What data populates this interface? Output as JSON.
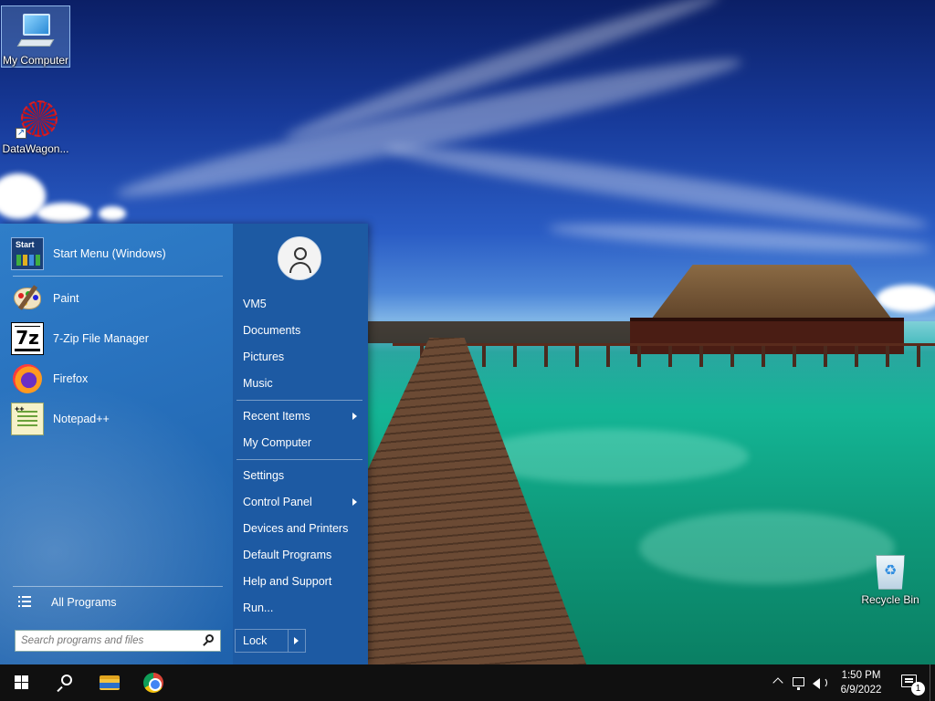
{
  "desktop": {
    "icons": [
      {
        "label": "My Computer",
        "icon": "computer-icon"
      },
      {
        "label": "DataWagon...",
        "icon": "datawagon-icon"
      },
      {
        "label": "Recycle Bin",
        "icon": "recycle-bin-icon"
      }
    ]
  },
  "start_menu": {
    "pinned": [
      {
        "label": "Start Menu (Windows)",
        "icon": "start-menu-app-icon"
      }
    ],
    "recent_programs": [
      {
        "label": "Paint",
        "icon": "paint-icon"
      },
      {
        "label": "7-Zip File Manager",
        "icon": "7zip-icon"
      },
      {
        "label": "Firefox",
        "icon": "firefox-icon"
      },
      {
        "label": "Notepad++",
        "icon": "notepad-plus-plus-icon"
      }
    ],
    "all_programs_label": "All Programs",
    "search_placeholder": "Search programs and files",
    "user_picture_icon": "user-icon",
    "right_items_group1": [
      "VM5",
      "Documents",
      "Pictures",
      "Music"
    ],
    "right_items_group2": [
      {
        "label": "Recent Items",
        "submenu": true
      },
      {
        "label": "My Computer",
        "submenu": false
      }
    ],
    "right_items_group3": [
      {
        "label": "Settings",
        "submenu": false
      },
      {
        "label": "Control Panel",
        "submenu": true
      },
      {
        "label": "Devices and Printers",
        "submenu": false
      },
      {
        "label": "Default Programs",
        "submenu": false
      },
      {
        "label": "Help and Support",
        "submenu": false
      },
      {
        "label": "Run...",
        "submenu": false
      }
    ],
    "lock_label": "Lock",
    "start_icon_text": "Start",
    "accent_color": "#2a74c0"
  },
  "taskbar": {
    "buttons": [
      "windows-start-icon",
      "search-icon",
      "file-explorer-icon",
      "chrome-icon"
    ],
    "tray": {
      "icons": [
        "show-hidden-icons-chevron",
        "network-icon",
        "volume-icon"
      ],
      "time": "1:50 PM",
      "date": "6/9/2022",
      "notification_count": "1"
    }
  },
  "colors": {
    "taskbar": "#101010",
    "start_menu_right_pane": "#1d5aa3"
  }
}
